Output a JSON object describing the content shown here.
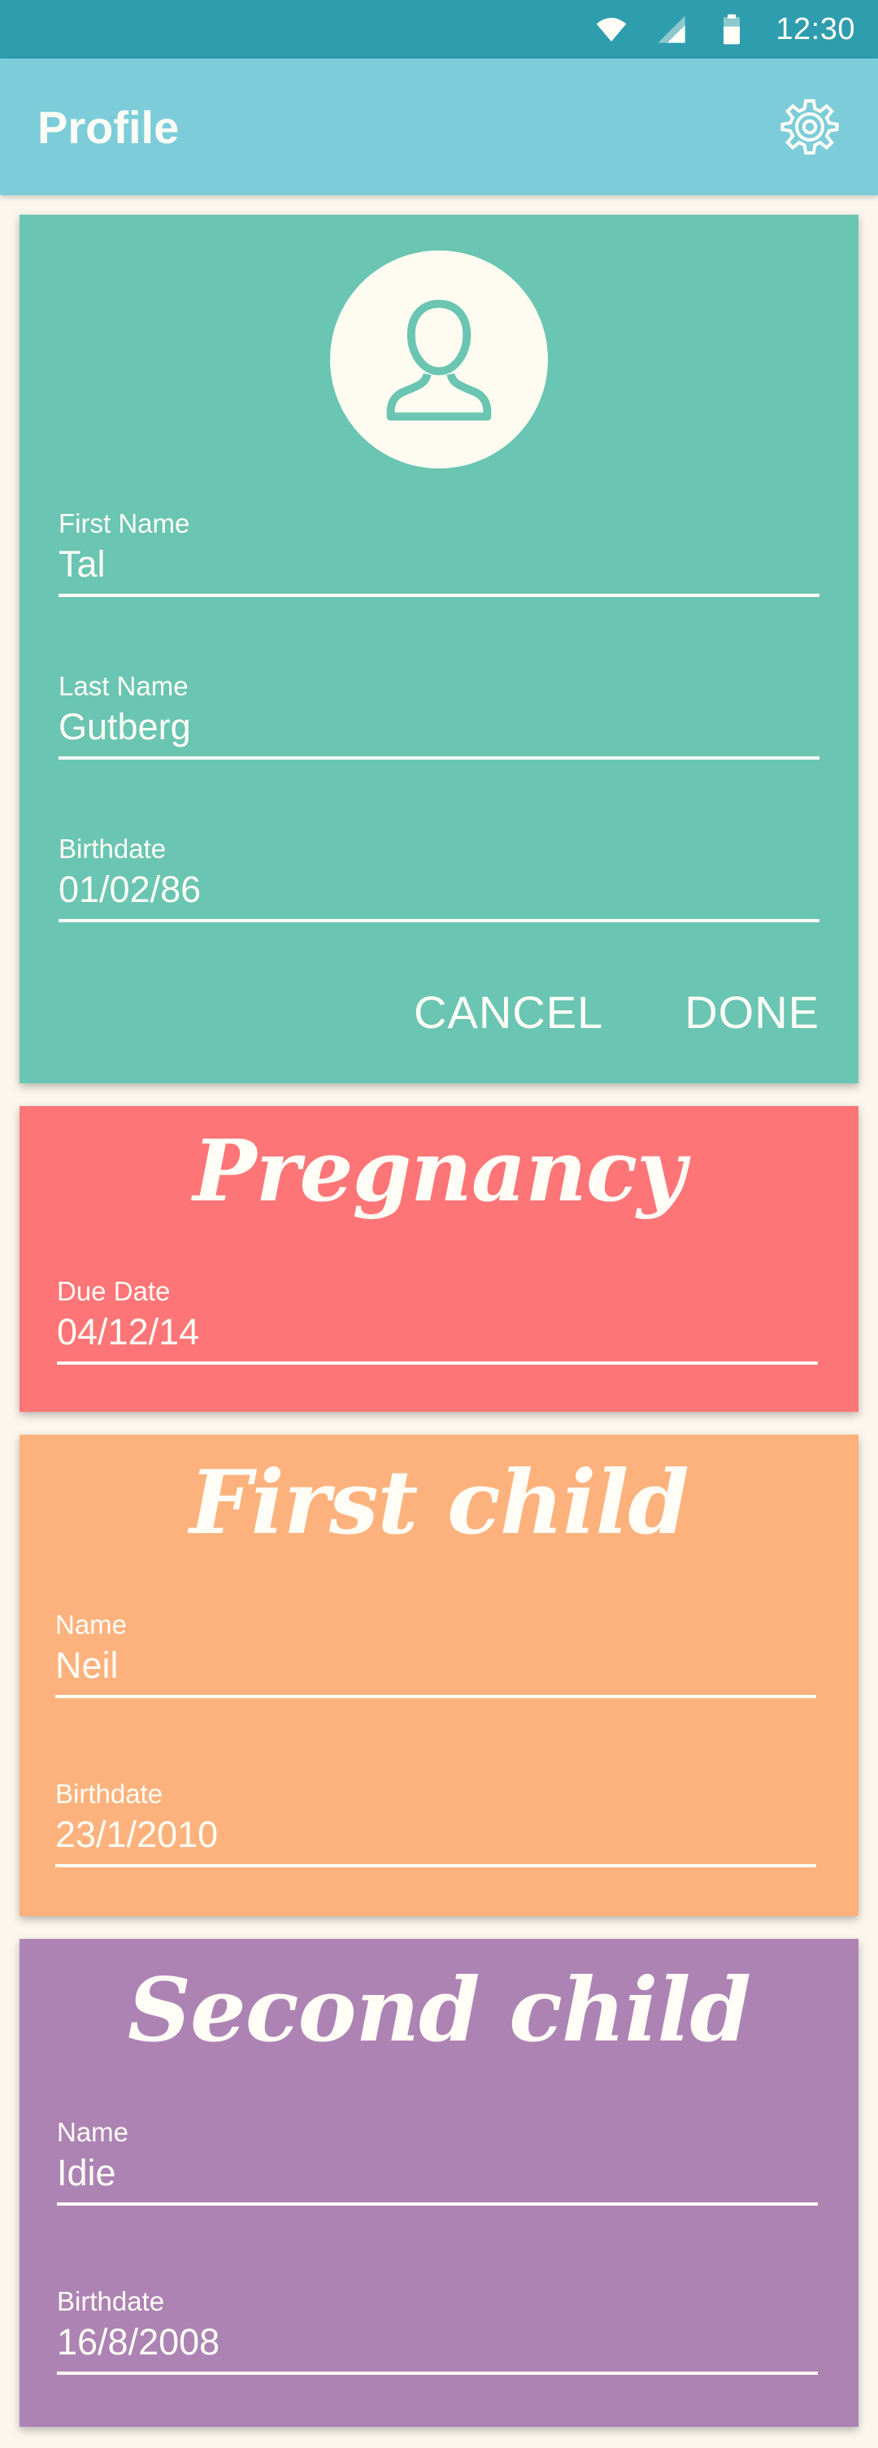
{
  "status_bar": {
    "time": "12:30",
    "icons": [
      "wifi-icon",
      "cellular-signal-icon",
      "battery-icon"
    ]
  },
  "app_bar": {
    "title": "Profile",
    "settings_icon": "gear-icon"
  },
  "profile_card": {
    "avatar_icon": "user-icon",
    "first_name": {
      "label": "First Name",
      "value": "Tal"
    },
    "last_name": {
      "label": "Last Name",
      "value": "Gutberg"
    },
    "birthdate": {
      "label": "Birthdate",
      "value": "01/02/86"
    },
    "cancel_label": "CANCEL",
    "done_label": "DONE"
  },
  "pregnancy_card": {
    "title": "Pregnancy",
    "due_date": {
      "label": "Due Date",
      "value": "04/12/14"
    }
  },
  "first_child_card": {
    "title": "First child",
    "name": {
      "label": "Name",
      "value": "Neil"
    },
    "birthdate": {
      "label": "Birthdate",
      "value": "23/1/2010"
    }
  },
  "second_child_card": {
    "title": "Second child",
    "name": {
      "label": "Name",
      "value": "Idie"
    },
    "birthdate": {
      "label": "Birthdate",
      "value": "16/8/2008"
    }
  },
  "colors": {
    "status_bar": "#2E9DAE",
    "app_bar": "#7CCDD9",
    "background": "#FCF7EE",
    "profile_card": "#6AC5B2",
    "pregnancy_card": "#FE7577",
    "first_child_card": "#FDB27D",
    "second_child_card": "#AD83B4",
    "text": "#FFFDF6"
  }
}
